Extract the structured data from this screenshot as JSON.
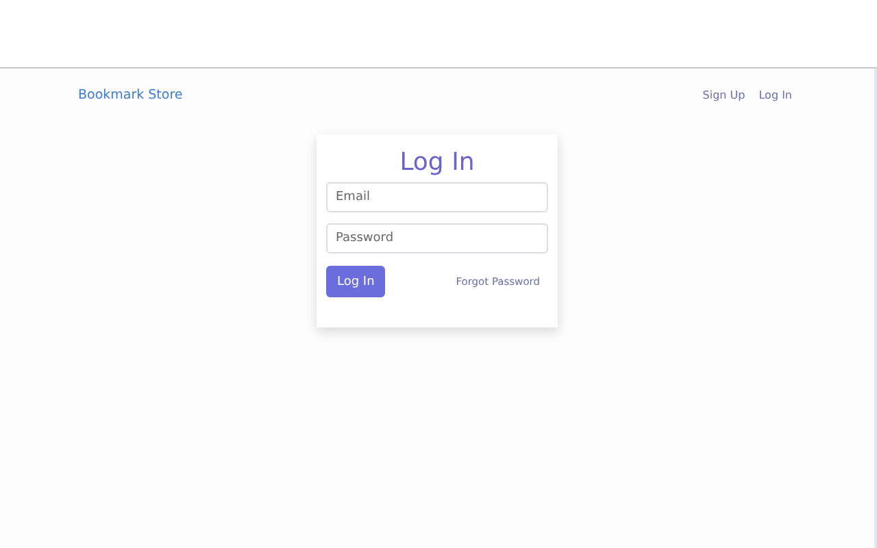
{
  "navbar": {
    "brand": "Bookmark Store",
    "links": [
      "Sign Up",
      "Log In"
    ]
  },
  "login": {
    "title": "Log In",
    "fields": [
      {
        "placeholder": "Email"
      },
      {
        "placeholder": "Password"
      }
    ],
    "submit": "Log In",
    "forgot": "Forgot Password"
  }
}
